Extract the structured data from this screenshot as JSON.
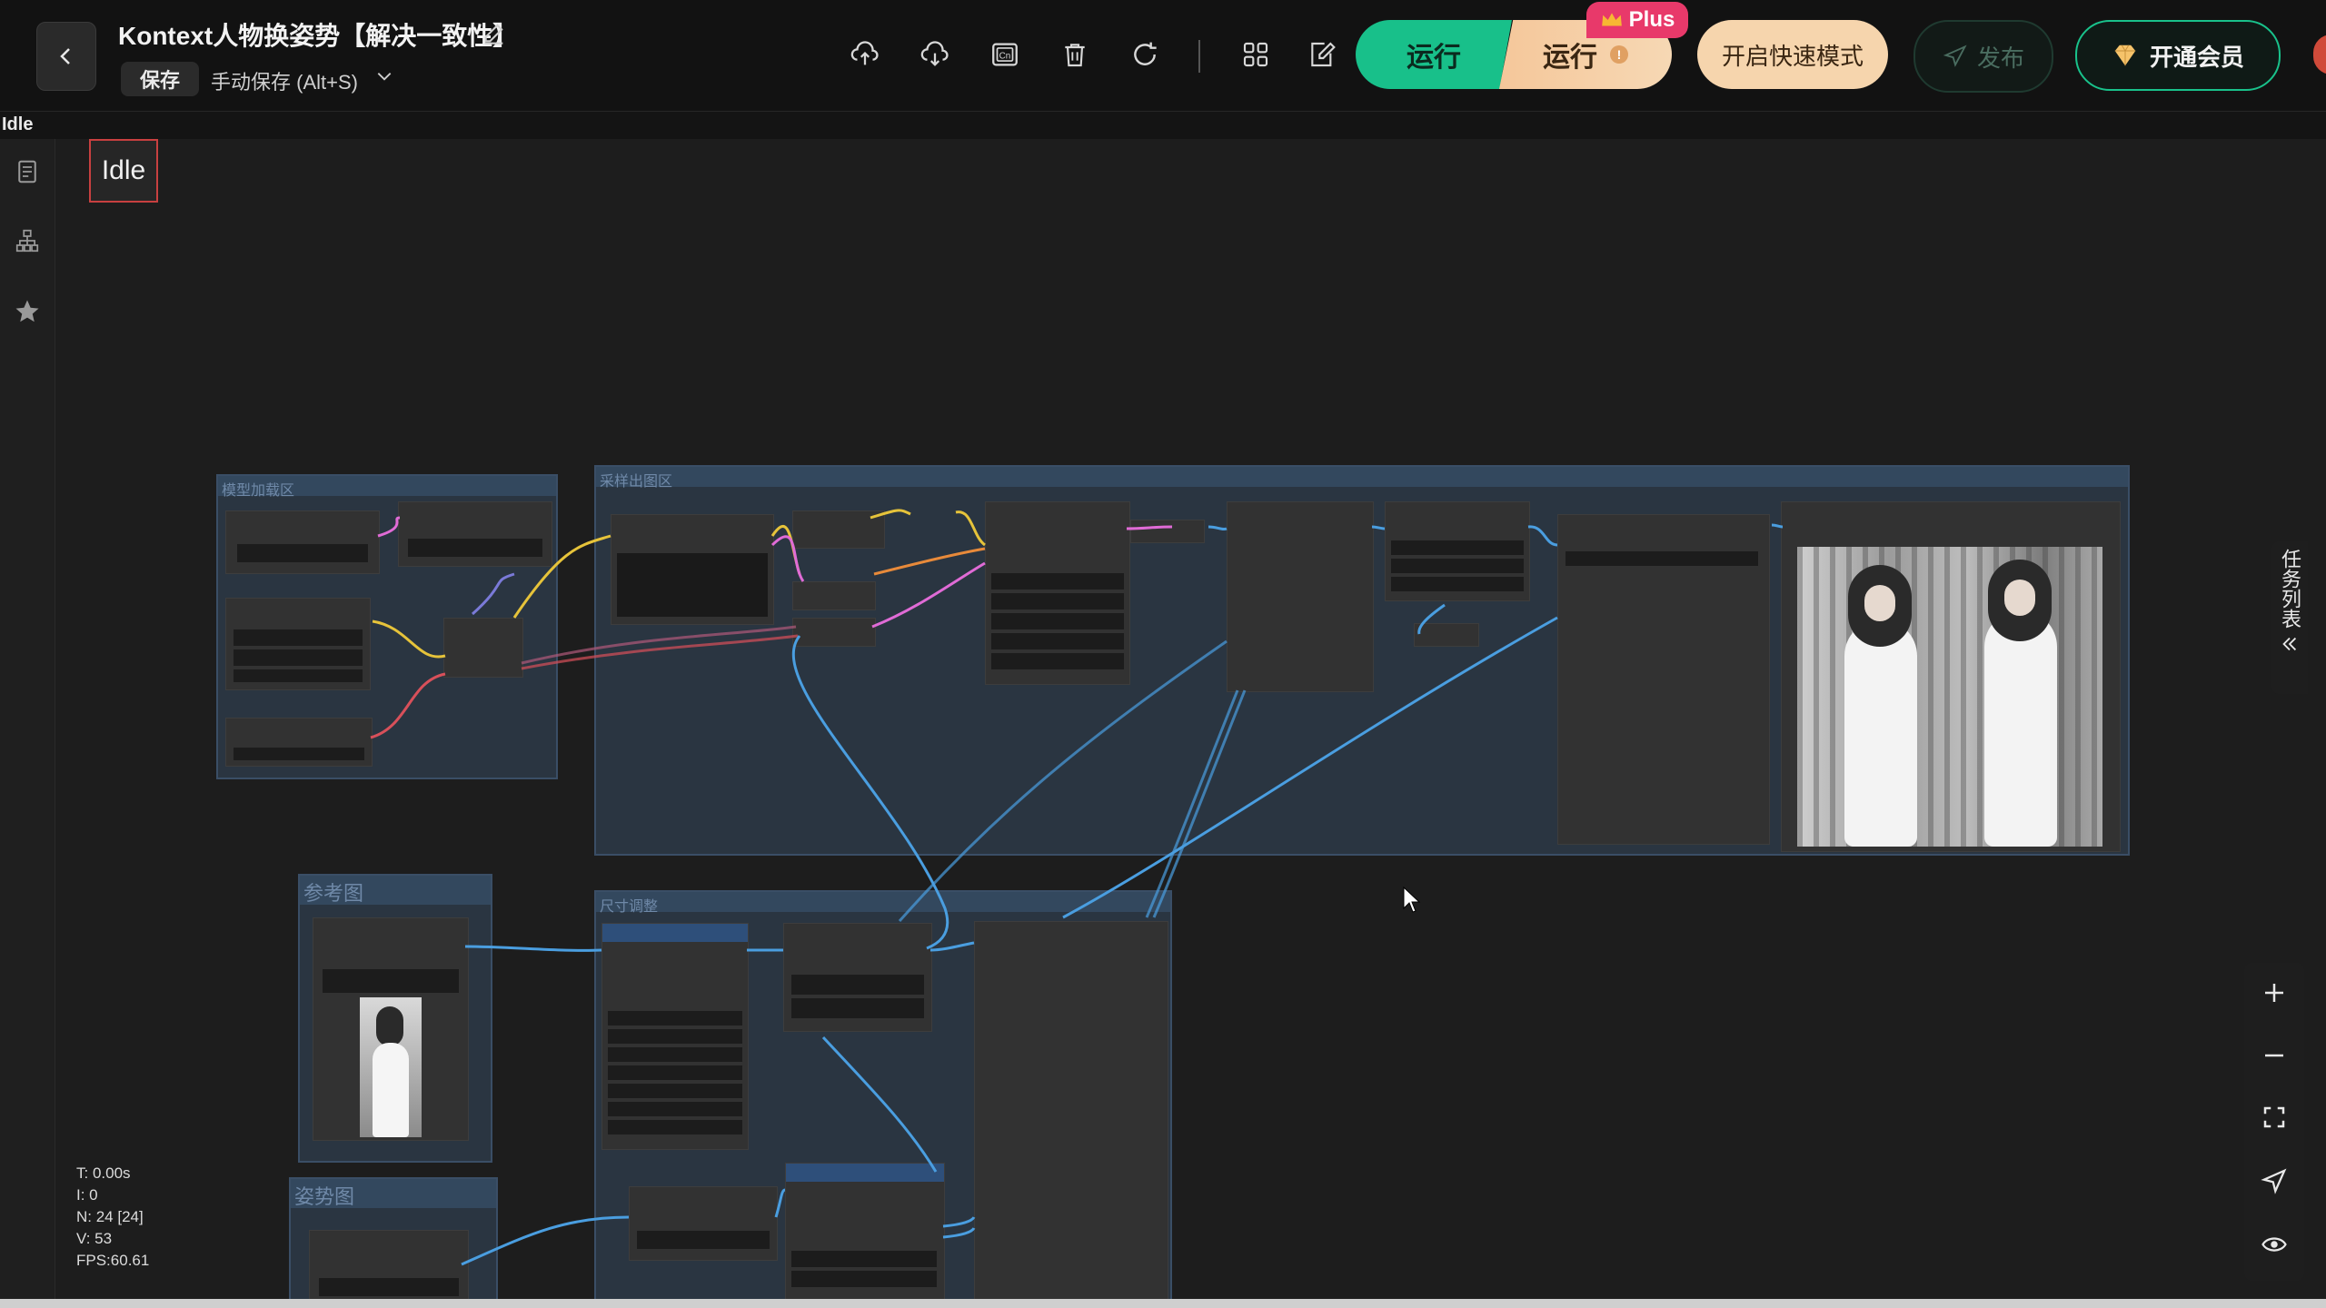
{
  "header": {
    "title": "Kontext人物换姿势【解决一致性】",
    "save_label": "保存",
    "save_mode": "手动保存 (Alt+S)"
  },
  "toolbar": {
    "icons": [
      "upload-icon",
      "download-icon",
      "cn-icon",
      "trash-icon",
      "refresh-icon",
      "grid-icon",
      "edit-note-icon"
    ]
  },
  "actions": {
    "run_label": "运行",
    "run_plus_label": "运行",
    "plus_badge": "Plus",
    "fast_mode_label": "开启快速模式",
    "publish_label": "发布",
    "vip_label": "开通会员"
  },
  "status": {
    "label": "Idle",
    "box_label": "Idle"
  },
  "canvas": {
    "groups": {
      "model_load": "模型加载区",
      "sampling_output": "采样出图区",
      "reference": "参考图",
      "size_adjust": "尺寸调整",
      "pose": "姿势图"
    },
    "stats": {
      "t": "T: 0.00s",
      "i": "I: 0",
      "n": "N: 24 [24]",
      "v": "V: 53",
      "fps": "FPS:60.61"
    }
  },
  "side_panel": {
    "task_list_label": "任务列表"
  },
  "colors": {
    "run_green": "#18c08a",
    "plus_pink": "#e8396a",
    "fast_mode_bg": "#f6d5ad",
    "group_bg": "#2a3541",
    "link_blue": "#4a9ee0",
    "link_yellow": "#e6c33a",
    "link_pink": "#e06bd6",
    "link_orange": "#e88a3a",
    "link_red": "#d8505a"
  }
}
